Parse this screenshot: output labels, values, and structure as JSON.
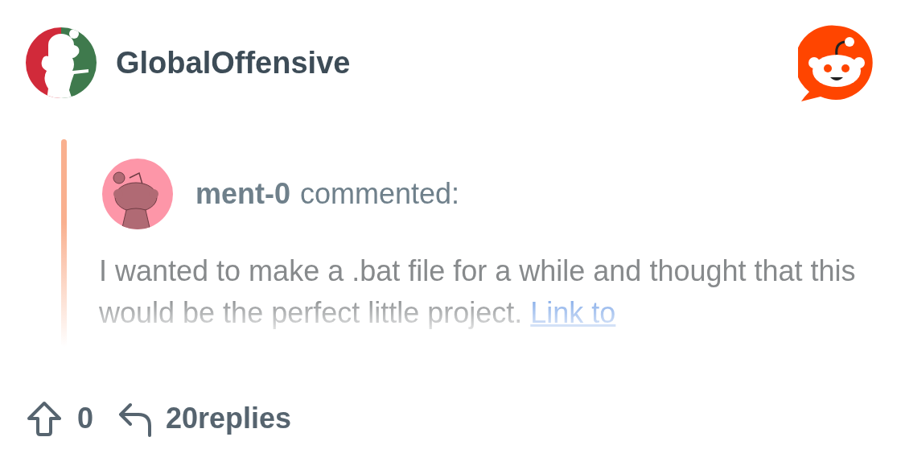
{
  "subreddit": {
    "name": "GlobalOffensive"
  },
  "comment": {
    "author": "ment-0",
    "action": "commented:",
    "text": "I wanted to make a .bat file for a while and thought that this would be the perfect little project.",
    "link": "Link to"
  },
  "footer": {
    "upvotes": "0",
    "replies": "20replies"
  }
}
